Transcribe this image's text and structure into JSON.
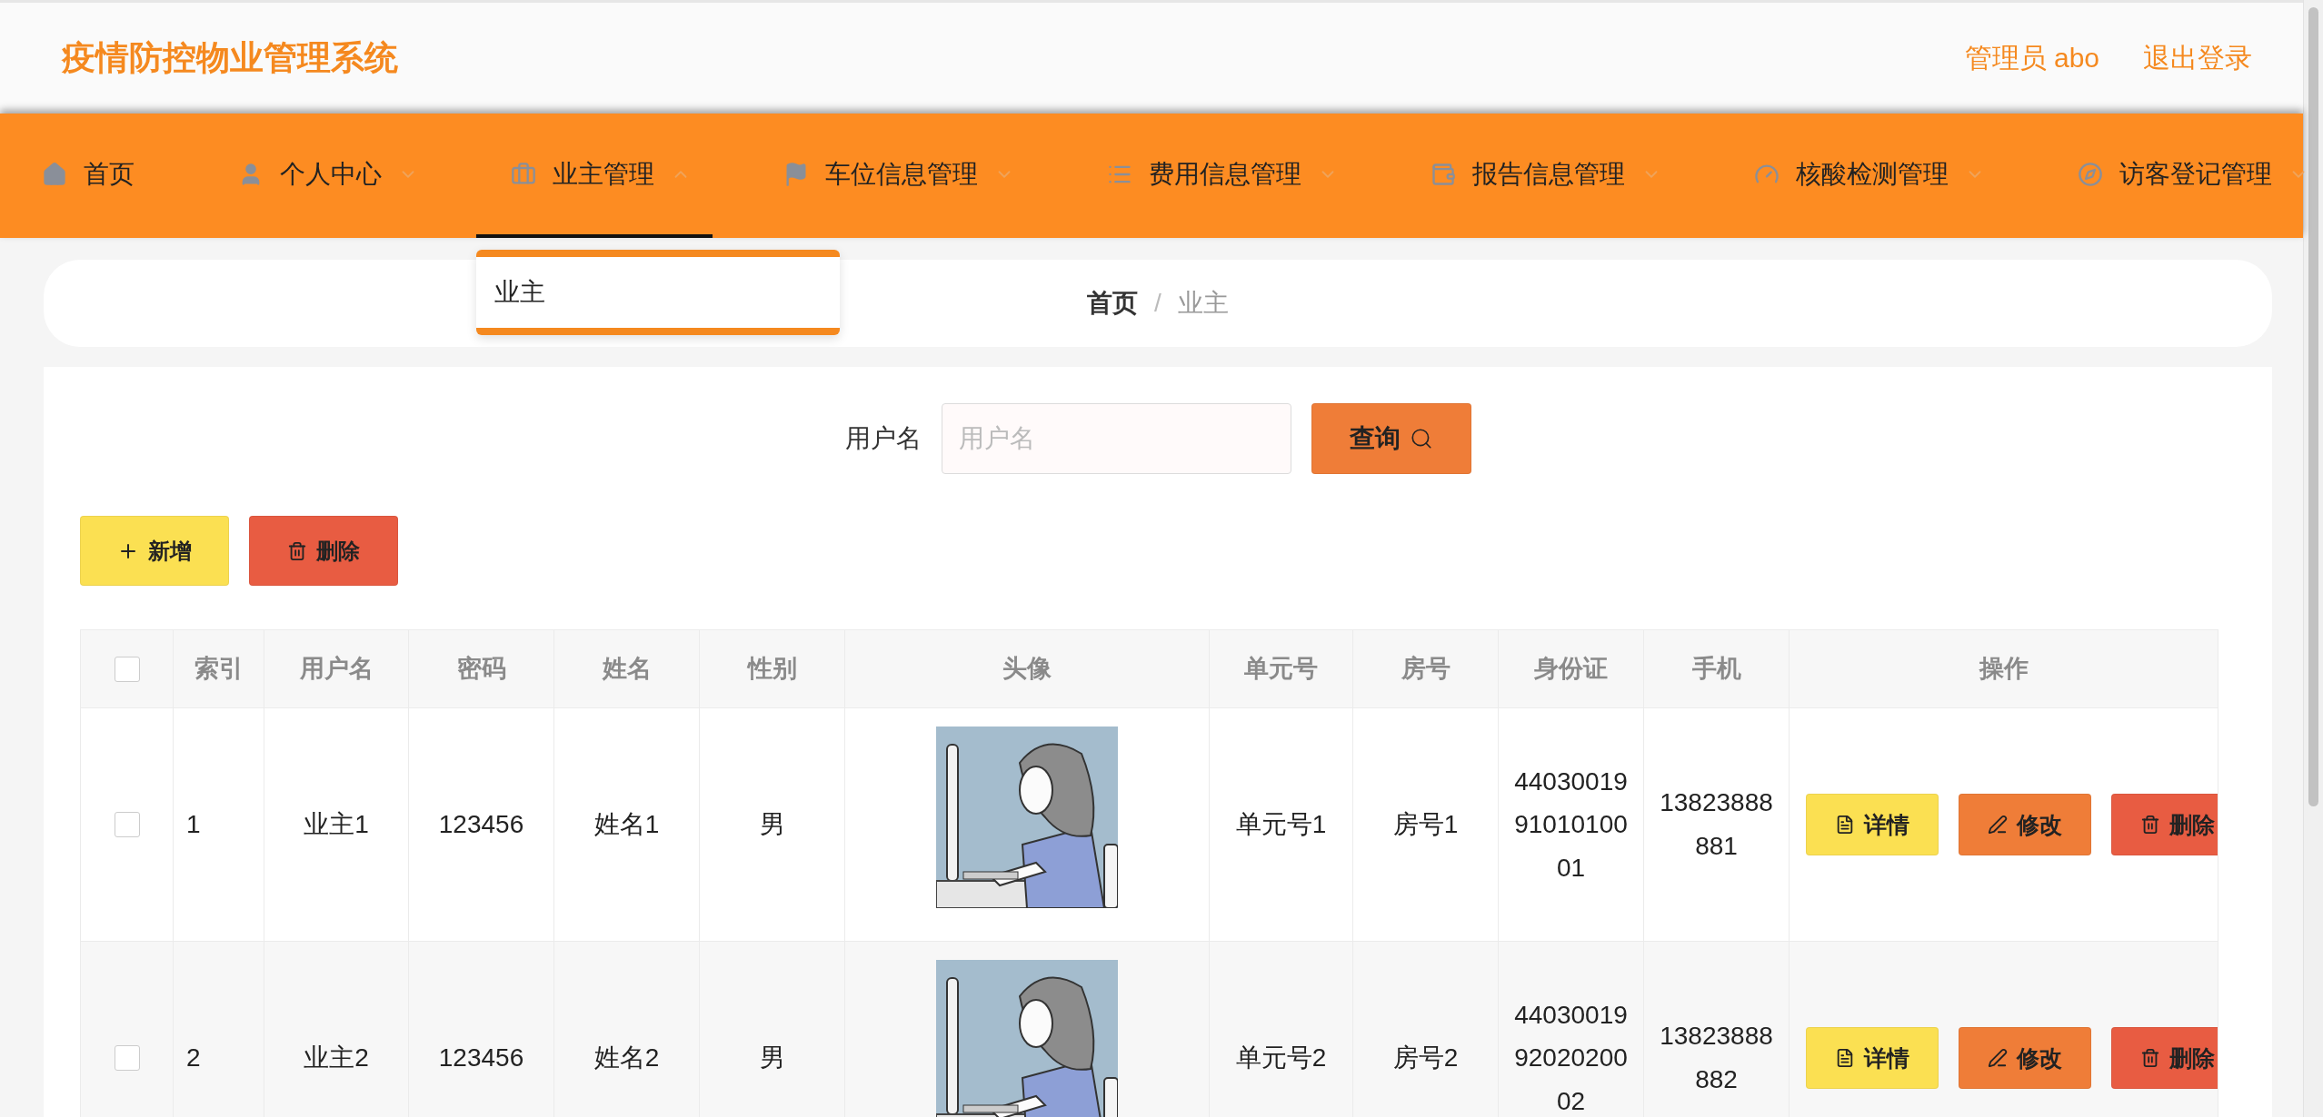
{
  "header": {
    "title": "疫情防控物业管理系统",
    "user": "管理员 abo",
    "logout": "退出登录"
  },
  "nav": [
    {
      "kind": "link",
      "label": "首页",
      "selected": false,
      "expanded": false
    },
    {
      "kind": "menu",
      "label": "个人中心",
      "selected": false,
      "expanded": false
    },
    {
      "kind": "menu",
      "label": "业主管理",
      "selected": true,
      "expanded": true
    },
    {
      "kind": "menu",
      "label": "车位信息管理",
      "selected": false,
      "expanded": false
    },
    {
      "kind": "menu",
      "label": "费用信息管理",
      "selected": false,
      "expanded": false
    },
    {
      "kind": "menu",
      "label": "报告信息管理",
      "selected": false,
      "expanded": false
    },
    {
      "kind": "menu",
      "label": "核酸检测管理",
      "selected": false,
      "expanded": false
    },
    {
      "kind": "menu",
      "label": "访客登记管理",
      "selected": false,
      "expanded": false
    }
  ],
  "dropdown": {
    "items": [
      {
        "label": "业主"
      }
    ]
  },
  "breadcrumb": [
    {
      "label": "首页",
      "current": false
    },
    {
      "label": "业主",
      "current": true
    }
  ],
  "breadcrumb_separator": "/",
  "search": {
    "label": "用户名",
    "placeholder": "用户名",
    "button": "查询"
  },
  "actions": [
    {
      "kind": "add",
      "label": "新增"
    },
    {
      "kind": "delete",
      "label": "删除"
    }
  ],
  "table": {
    "header_checked": false,
    "columns": [
      "索引",
      "用户名",
      "密码",
      "姓名",
      "性别",
      "头像",
      "单元号",
      "房号",
      "身份证",
      "手机",
      "操作"
    ],
    "rows": [
      {
        "checked": false,
        "cells": [
          "1",
          "业主1",
          "123456",
          "姓名1",
          "男"
        ],
        "avatar": {
          "kind": "picture"
        },
        "cells2": [
          "单元号1",
          "房号1",
          "440300199101010001",
          "13823888881"
        ],
        "buttons": [
          {
            "kind": "detail",
            "label": "详情"
          },
          {
            "kind": "edit",
            "label": "修改"
          },
          {
            "kind": "delete",
            "label": "删除"
          }
        ]
      },
      {
        "checked": false,
        "cells": [
          "2",
          "业主2",
          "123456",
          "姓名2",
          "男"
        ],
        "avatar": {
          "kind": "picture"
        },
        "cells2": [
          "单元号2",
          "房号2",
          "440300199202020002",
          "13823888882"
        ],
        "buttons": [
          {
            "kind": "detail",
            "label": "详情"
          },
          {
            "kind": "edit",
            "label": "修改"
          },
          {
            "kind": "delete",
            "label": "删除"
          }
        ]
      }
    ]
  }
}
